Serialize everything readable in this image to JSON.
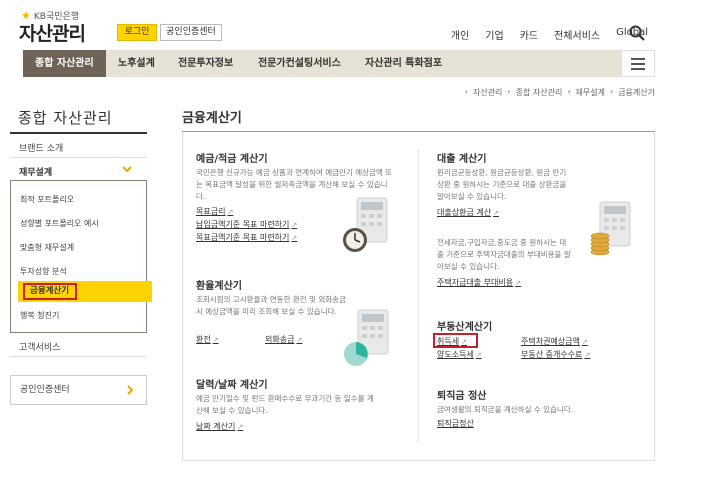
{
  "header": {
    "bank_name": "KB국민은행",
    "site_title": "자산관리",
    "login_label": "로그인",
    "cert_label": "공인인증센터",
    "top_links": [
      "개인",
      "기업",
      "카드",
      "전체서비스",
      "Global"
    ]
  },
  "gnb": {
    "items": [
      "종합 자산관리",
      "노후설계",
      "전문투자정보",
      "전문가컨설팅서비스",
      "자산관리 특화점포"
    ]
  },
  "breadcrumb": [
    "자산관리",
    "종합 자산관리",
    "재무설계",
    "금융계산기"
  ],
  "lnb": {
    "title": "종합 자산관리",
    "brand": "브랜드 소개",
    "finance": "재무설계",
    "sub_items": [
      "최적 포트폴리오",
      "성향별 포트폴리오 예시",
      "맞춤형 재무설계",
      "투자성향 분석",
      "금융계산기",
      "행복 청진기"
    ],
    "customer_service": "고객서비스",
    "cert_center": "공인인증센터"
  },
  "main": {
    "title": "금융계산기",
    "deposit": {
      "title": "예금/적금 계산기",
      "desc": "국민은행 신규가능 예금 상품과 연계하여 예금만기 예상금액 또는 목표금액 달성을 위한 월저축금액을 계산해 보실 수 있습니다.",
      "links": [
        "목표금리",
        "납입금액기준 목표 마련하기",
        "목표금액기준 목표 마련하기"
      ]
    },
    "loan": {
      "title": "대출 계산기",
      "desc1": "원리금균등상환, 원금균등상환, 원금 만기상환 중 원하시는 기준으로 대출 상환금을 알아보실 수 있습니다.",
      "link1": "대출상환금 계산",
      "desc2": "전세자금,구입자금,중도금 중 원하시는 대출 기준으로 주택자금대출의 부대비용을 알아보실 수 있습니다.",
      "link2": "주택자금대출 부대비용"
    },
    "exchange": {
      "title": "환율계산기",
      "desc": "조회시점의 고시환율과 연동한 환전 및 외화송금 시 예상금액을 미리 조회해 보실 수 있습니다.",
      "links": [
        "환전",
        "외화송금"
      ]
    },
    "realestate": {
      "title": "부동산계산기",
      "links": [
        "취득세",
        "주택처권예상금액",
        "양도소득세",
        "부동산 중개수수료"
      ]
    },
    "date": {
      "title": "달력/날짜 계산기",
      "desc": "예금 만기일수 및 펀드 환매수수료 무과기간 등 일수를 계산해 보실 수 있습니다.",
      "link": "날짜 계산기"
    },
    "retirement": {
      "title": "퇴직금 정산",
      "desc": "금여생활의 퇴직금을 계산하실 수 있습니다.",
      "link": "퇴직금정산"
    }
  },
  "colors": {
    "brand_yellow": "#ffd300",
    "gnb_active": "#6f6357",
    "gnb_bg": "#e6e2d6",
    "highlight_red": "#c8202a"
  }
}
